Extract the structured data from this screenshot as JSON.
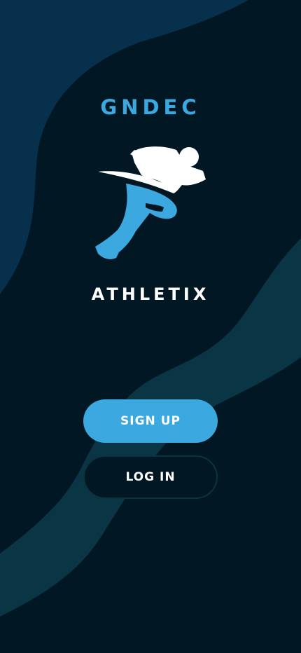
{
  "brand": {
    "top_text": "GNDEC",
    "bottom_text": "ATHLETIX"
  },
  "logo": {
    "icon": "running-athlete-icon"
  },
  "buttons": {
    "signup_label": "SIGN UP",
    "login_label": "LOG IN"
  },
  "colors": {
    "background": "#011723",
    "accent": "#3ba8e0",
    "shape_dark": "#07304d",
    "shape_teal": "#0a3544",
    "text": "#ffffff"
  }
}
